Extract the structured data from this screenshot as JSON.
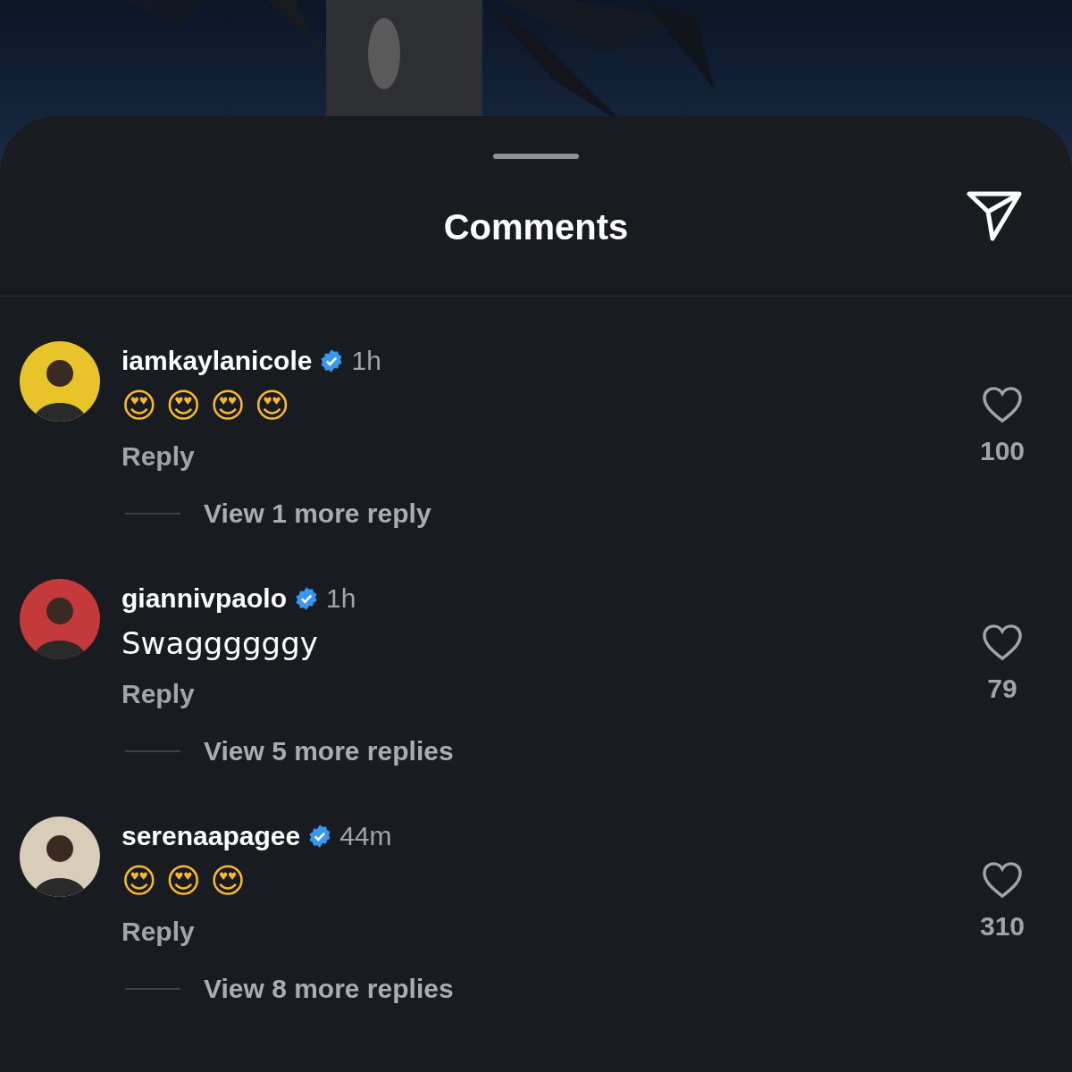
{
  "header": {
    "title": "Comments"
  },
  "comments": [
    {
      "username": "iamkaylanicole",
      "verified": true,
      "time": "1h",
      "text": "😍😍😍😍",
      "kind": "emoji",
      "reply": "Reply",
      "likes": "100",
      "view_replies": "View 1 more reply"
    },
    {
      "username": "giannivpaolo",
      "verified": true,
      "time": "1h",
      "text": "Swaggggggy",
      "kind": "text",
      "reply": "Reply",
      "likes": "79",
      "view_replies": "View 5 more replies"
    },
    {
      "username": "serenaapagee",
      "verified": true,
      "time": "44m",
      "text": "😍😍😍",
      "kind": "emoji",
      "reply": "Reply",
      "likes": "310",
      "view_replies": "View 8 more replies"
    }
  ]
}
